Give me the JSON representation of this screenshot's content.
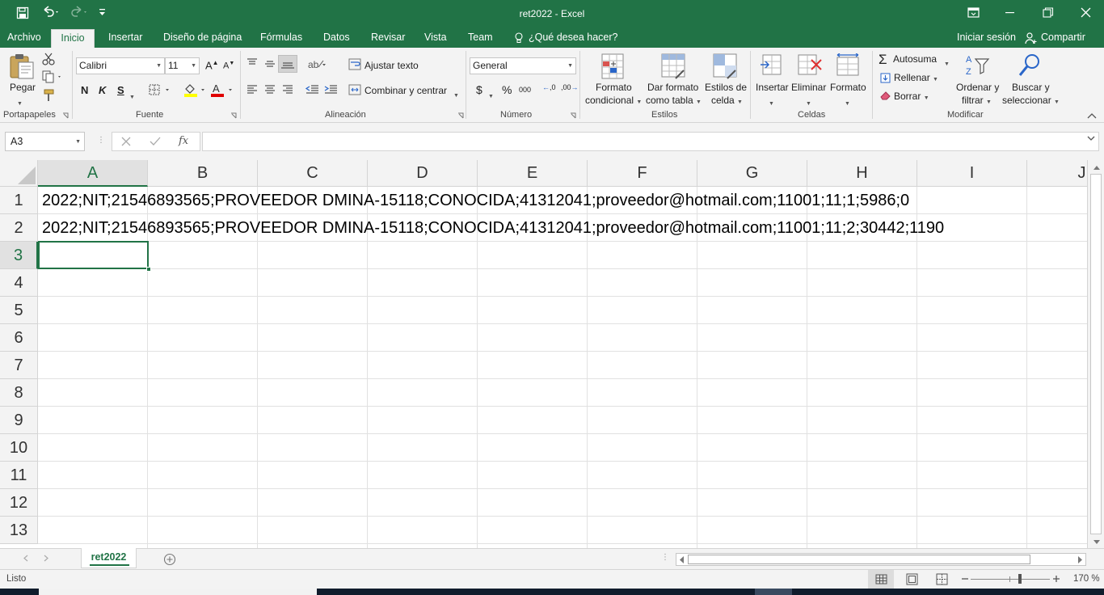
{
  "window": {
    "title": "ret2022 - Excel"
  },
  "ribbon_tabs": [
    "Archivo",
    "Inicio",
    "Insertar",
    "Diseño de página",
    "Fórmulas",
    "Datos",
    "Revisar",
    "Vista",
    "Team"
  ],
  "tell_me": "¿Qué desea hacer?",
  "account": {
    "signin": "Iniciar sesión",
    "share": "Compartir"
  },
  "clipboard": {
    "paste": "Pegar",
    "label": "Portapapeles"
  },
  "font": {
    "name": "Calibri",
    "size": "11",
    "bold": "N",
    "italic": "K",
    "underline": "S",
    "grow": "A",
    "shrink": "A",
    "color_glyph": "A",
    "label": "Fuente"
  },
  "alignment": {
    "wrap": "Ajustar texto",
    "merge": "Combinar y centrar",
    "label": "Alineación"
  },
  "number": {
    "format": "General",
    "currency": "$",
    "percent": "%",
    "thousands": "000",
    "inc_dec": ",0",
    "dec_dec": ",00",
    "label": "Número"
  },
  "styles": {
    "conditional_1": "Formato",
    "conditional_2": "condicional",
    "table_1": "Dar formato",
    "table_2": "como tabla",
    "cell_1": "Estilos de",
    "cell_2": "celda",
    "label": "Estilos"
  },
  "cells": {
    "insert": "Insertar",
    "delete": "Eliminar",
    "format": "Formato",
    "label": "Celdas"
  },
  "editing": {
    "autosum": "Autosuma",
    "fill": "Rellenar",
    "clear": "Borrar",
    "sort_1": "Ordenar y",
    "sort_2": "filtrar",
    "find_1": "Buscar y",
    "find_2": "seleccionar",
    "label": "Modificar"
  },
  "formula_bar": {
    "name_box": "A3",
    "fx": "fx",
    "value": ""
  },
  "grid": {
    "columns": [
      "A",
      "B",
      "C",
      "D",
      "E",
      "F",
      "G",
      "H",
      "I",
      "J"
    ],
    "selected_column": "A",
    "selected_row": "3",
    "rows": [
      "1",
      "2",
      "3",
      "4",
      "5",
      "6",
      "7",
      "8",
      "9",
      "10",
      "11",
      "12",
      "13"
    ],
    "cells": {
      "A1": "2022;NIT;21546893565;PROVEEDOR DMINA-15118;CONOCIDA;41312041;proveedor@hotmail.com;11001;11;1;5986;0",
      "A2": "2022;NIT;21546893565;PROVEEDOR DMINA-15118;CONOCIDA;41312041;proveedor@hotmail.com;11001;11;2;30442;1190"
    }
  },
  "sheets": {
    "active": "ret2022"
  },
  "status": {
    "mode": "Listo",
    "zoom": "170 %"
  },
  "colors": {
    "excel_green": "#217346",
    "ribbon_bg": "#f3f3f3"
  }
}
